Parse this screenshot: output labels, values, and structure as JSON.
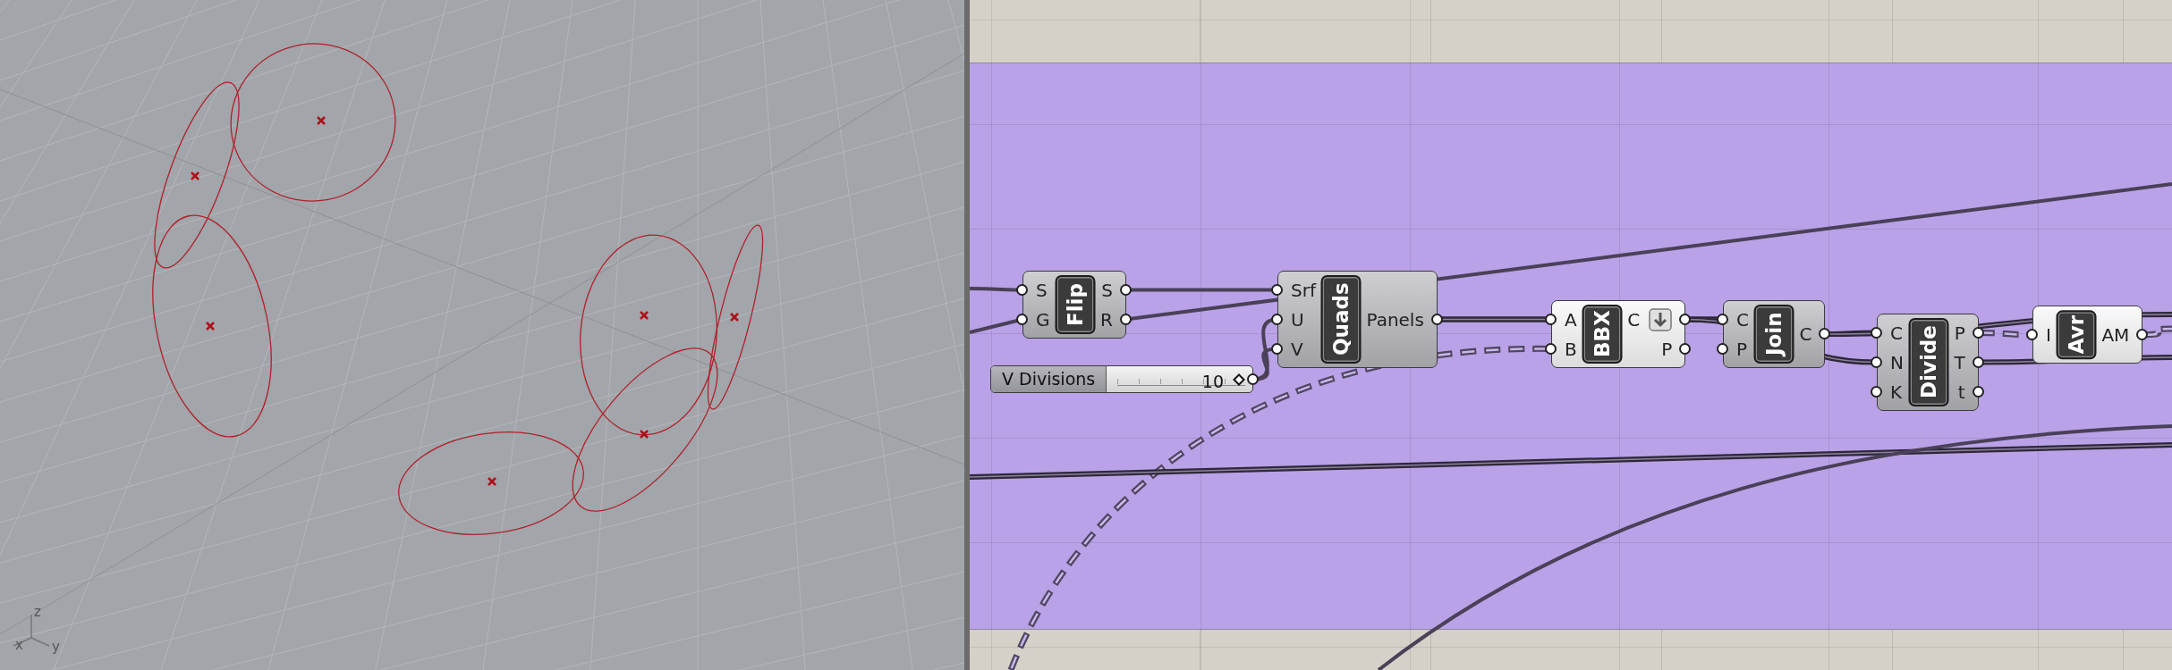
{
  "viewport": {
    "axis_labels": [
      "z",
      "x",
      "y"
    ]
  },
  "canvas": {
    "components": [
      {
        "kind": "component",
        "name": "Flip",
        "inputs": [
          "S",
          "G"
        ],
        "outputs": [
          "S",
          "R"
        ],
        "preview": true,
        "options_button": false
      },
      {
        "kind": "component",
        "name": "Quads",
        "inputs": [
          "Srf",
          "U",
          "V"
        ],
        "outputs": [
          "Panels"
        ],
        "preview": true,
        "options_button": false
      },
      {
        "kind": "slider",
        "name": "V Divisions",
        "value": "10",
        "level": 1
      },
      {
        "kind": "component",
        "name": "BBX",
        "inputs": [
          "A",
          "B"
        ],
        "outputs": [
          "C",
          "P"
        ],
        "preview": false,
        "options_button": true
      },
      {
        "kind": "component",
        "name": "Join",
        "inputs": [
          "C",
          "P"
        ],
        "outputs": [
          "C"
        ],
        "preview": true,
        "options_button": false
      },
      {
        "kind": "component",
        "name": "Divide",
        "inputs": [
          "C",
          "N",
          "K"
        ],
        "outputs": [
          "P",
          "T",
          "t"
        ],
        "preview": true,
        "options_button": false
      },
      {
        "kind": "component",
        "name": "Avr",
        "inputs": [
          "I"
        ],
        "outputs": [
          "AM"
        ],
        "preview": false,
        "options_button": false
      }
    ]
  }
}
